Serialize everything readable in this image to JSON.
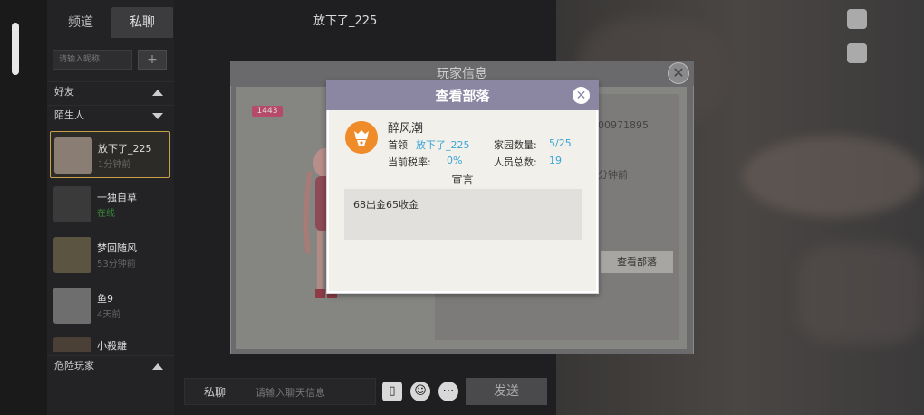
{
  "chat": {
    "tabs": [
      {
        "label": "频道"
      },
      {
        "label": "私聊"
      }
    ],
    "search_placeholder": "请输入昵称",
    "add_label": "+",
    "sections": {
      "friends": "好友",
      "strangers": "陌生人",
      "danger": "危险玩家"
    },
    "contacts": [
      {
        "name": "放下了_225",
        "status": "1分钟前"
      },
      {
        "name": "一独自草",
        "status": "在线"
      },
      {
        "name": "梦回随风",
        "status": "53分钟前"
      },
      {
        "name": "鱼9",
        "status": "4天前"
      },
      {
        "name": "小殺離",
        "status": ""
      }
    ],
    "current_partner": "放下了_225",
    "input_label": "私聊",
    "input_placeholder": "请输入聊天信息",
    "send_label": "发送"
  },
  "player_info": {
    "title": "玩家信息",
    "level": "1443",
    "id_partial": "00971895",
    "last_seen_partial": "分钟前",
    "view_tribe_label": "查看部落"
  },
  "tribe": {
    "title": "查看部落",
    "name": "醉风潮",
    "leader_label": "首领",
    "leader_value": "放下了_225",
    "tax_label": "当前税率:",
    "tax_value": "0%",
    "home_label": "家园数量:",
    "home_value": "5/25",
    "members_label": "人员总数:",
    "members_value": "19",
    "declaration_label": "宣言",
    "declaration_text": "68出金65收金"
  },
  "colors": {
    "tribe_header": "#8b87a2",
    "value_blue": "#3ba4d6",
    "logo_orange": "#f08b2a",
    "selected_border": "#c8a24a"
  }
}
